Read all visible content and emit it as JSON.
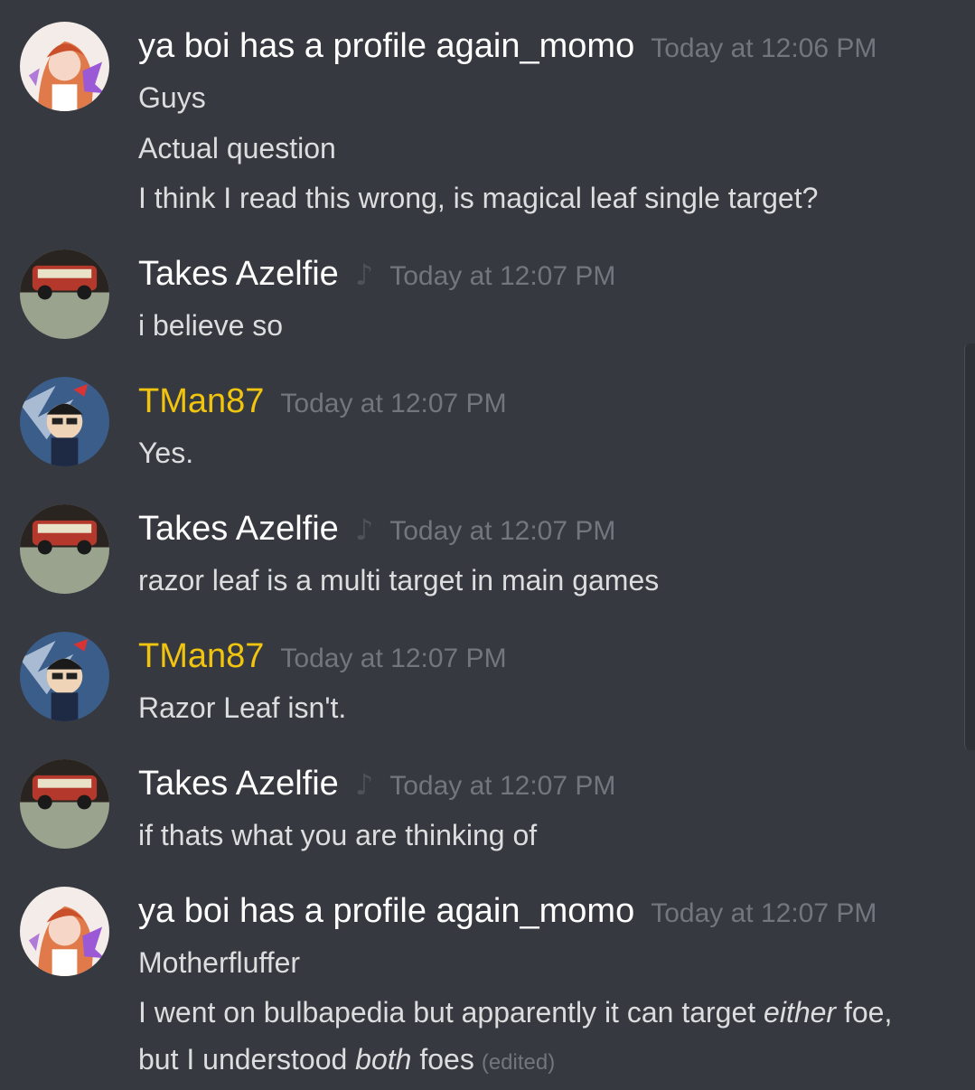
{
  "messages": [
    {
      "username": "ya boi has a profile again_momo",
      "timestamp": "Today at 12:06 PM",
      "lines": [
        "Guys",
        "Actual question",
        "I think I read this wrong, is magical leaf single target?"
      ]
    },
    {
      "username": "Takes Azelfie",
      "timestamp": "Today at 12:07 PM",
      "lines": [
        "i believe so"
      ]
    },
    {
      "username": "TMan87",
      "timestamp": "Today at 12:07 PM",
      "lines": [
        "Yes."
      ]
    },
    {
      "username": "Takes Azelfie",
      "timestamp": "Today at 12:07 PM",
      "lines": [
        "razor leaf is a multi target in main games"
      ]
    },
    {
      "username": "TMan87",
      "timestamp": "Today at 12:07 PM",
      "lines": [
        "Razor Leaf isn't."
      ]
    },
    {
      "username": "Takes Azelfie",
      "timestamp": "Today at 12:07 PM",
      "lines": [
        "if thats what you are thinking of"
      ]
    },
    {
      "username": "ya boi has a profile again_momo",
      "timestamp": "Today at 12:07 PM",
      "lines": [
        "Motherfluffer"
      ],
      "line2": {
        "before": "I went on bulbapedia but apparently it can target ",
        "emphasis": "either",
        "after": " foe,"
      },
      "line3": {
        "before": "but I understood ",
        "emphasis": "both",
        "after": " foes",
        "edited": "(edited)"
      }
    }
  ],
  "icons": {
    "now_playing": "music-note-icon",
    "now_playing_glyph": "♪"
  },
  "colors": {
    "background": "#36393f",
    "username_default": "#ffffff",
    "username_gold": "#f1c40f",
    "timestamp": "#72767d",
    "message_text": "#dcddde"
  }
}
